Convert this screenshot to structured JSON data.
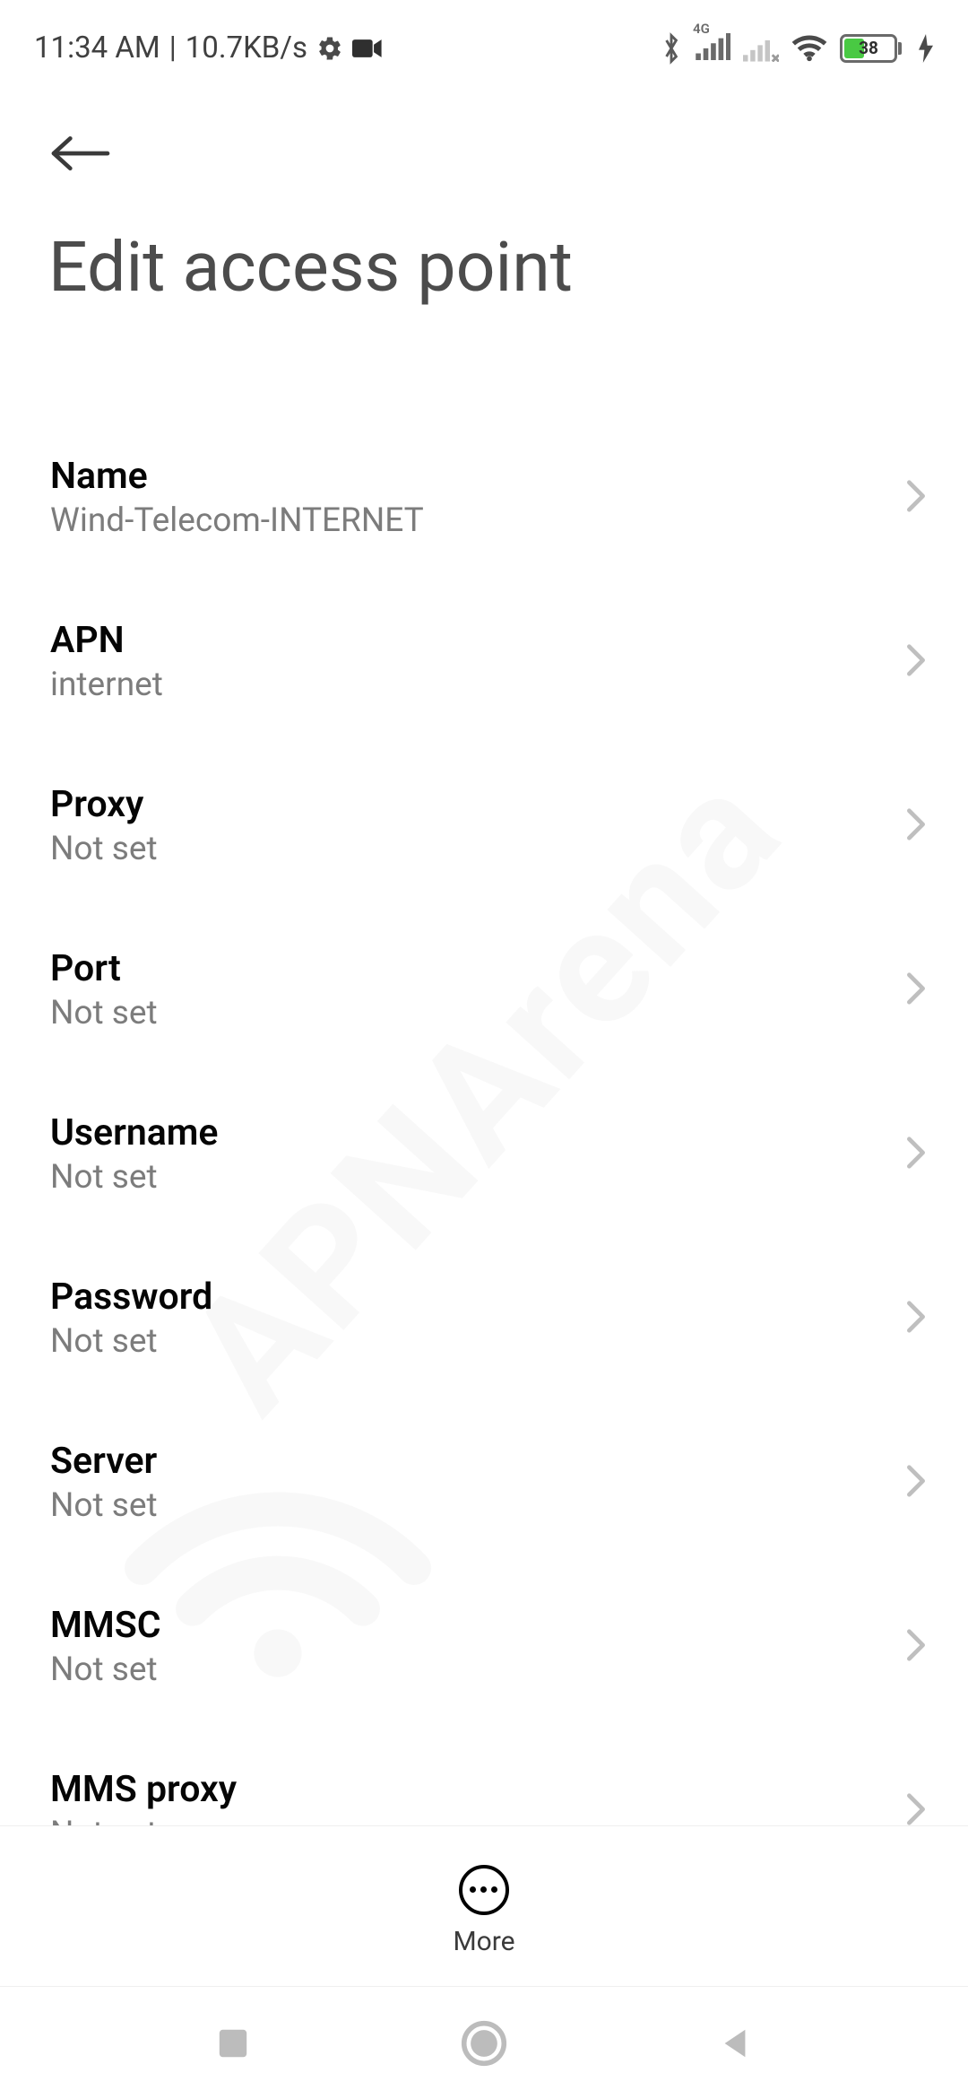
{
  "status_bar": {
    "time": "11:34 AM",
    "separator": "|",
    "net_speed": "10.7KB/s",
    "battery_percent": "38",
    "net_label": "4G"
  },
  "header": {
    "title": "Edit access point"
  },
  "settings": [
    {
      "label": "Name",
      "value": "Wind-Telecom-INTERNET"
    },
    {
      "label": "APN",
      "value": "internet"
    },
    {
      "label": "Proxy",
      "value": "Not set"
    },
    {
      "label": "Port",
      "value": "Not set"
    },
    {
      "label": "Username",
      "value": "Not set"
    },
    {
      "label": "Password",
      "value": "Not set"
    },
    {
      "label": "Server",
      "value": "Not set"
    },
    {
      "label": "MMSC",
      "value": "Not set"
    },
    {
      "label": "MMS proxy",
      "value": "Not set"
    }
  ],
  "action_bar": {
    "more_label": "More"
  },
  "watermark": {
    "text": "APNArena"
  }
}
